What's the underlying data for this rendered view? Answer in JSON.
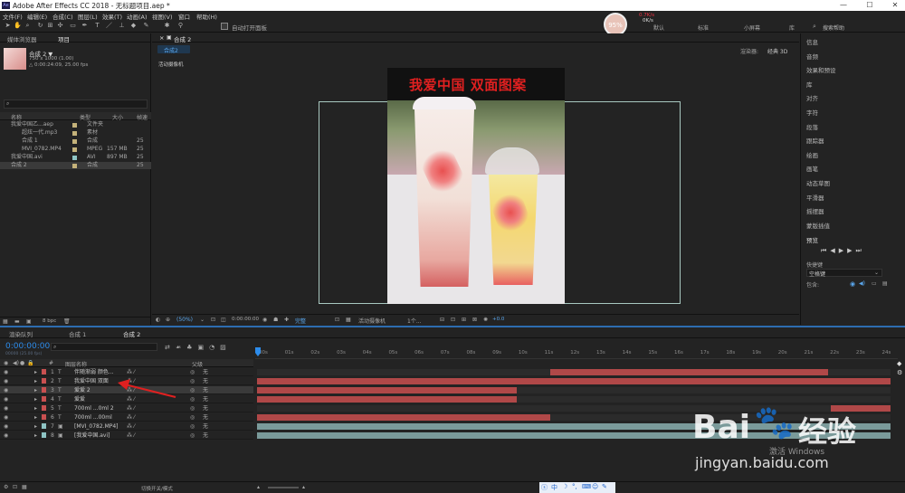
{
  "window": {
    "title": "Adobe After Effects CC 2018 - 无标题项目.aep *",
    "app_icon": "Ae",
    "controls": [
      "—",
      "☐",
      "✕"
    ]
  },
  "menu": [
    "文件(F)",
    "编辑(E)",
    "合成(C)",
    "图层(L)",
    "效果(T)",
    "动画(A)",
    "视图(V)",
    "窗口",
    "帮助(H)"
  ],
  "toolbar": {
    "auto_open_panel": "自动打开面板",
    "workspaces": [
      "默认",
      "标准",
      "小屏幕",
      "库"
    ],
    "search_placeholder": "搜索帮助",
    "speed_badge": "95%",
    "net_up": "0.7K/s",
    "net_down": "0K/s"
  },
  "project_panel": {
    "tabs": [
      "媒体浏览器",
      "项目"
    ],
    "comp_name": "合成 2 ▼",
    "comp_size": "750 x 1000 (1.00)",
    "comp_duration": "△ 0:00:24:09, 25.00 fps",
    "columns": {
      "name": "名称",
      "type": "类型",
      "size": "大小",
      "fps": "帧速"
    },
    "items": [
      {
        "name": "我爱中国乙...aep",
        "type": "文件夹",
        "size": "",
        "fps": "",
        "label_color": "#c4b27a"
      },
      {
        "name": "超炫一代.mp3",
        "type": "素材",
        "size": "",
        "fps": "",
        "label_color": "#c4b27a"
      },
      {
        "name": "合成 1",
        "type": "合成",
        "size": "",
        "fps": "25",
        "label_color": "#c4b27a"
      },
      {
        "name": "MVI_0782.MP4",
        "type": "MPEG",
        "size": "157 MB",
        "fps": "25",
        "label_color": "#c4b27a"
      },
      {
        "name": "我爱中国.avi",
        "type": "AVI",
        "size": "897 MB",
        "fps": "25",
        "label_color": "#8ec4c4"
      },
      {
        "name": "合成 2",
        "type": "合成",
        "size": "",
        "fps": "25",
        "label_color": "#c4b27a"
      }
    ],
    "footer_bpc": "8 bpc"
  },
  "comp_viewer": {
    "tab": "合成 2",
    "breadcrumb": "合成2",
    "renderer_label": "渲染器:",
    "renderer_value": "经典 3D",
    "camera_label": "活动摄像机",
    "video_caption": "我爱中国 双面图案",
    "footer": {
      "zoom": "(50%)",
      "timecode": "0:00:00:00",
      "quality": "完整",
      "camera": "活动摄像机",
      "views": "1个...",
      "offset": "+0.0"
    }
  },
  "right_panel": {
    "items": [
      "信息",
      "音频",
      "效果和预设",
      "库",
      "对齐",
      "字符",
      "段落",
      "跟踪器",
      "绘画",
      "画笔",
      "动态草图",
      "平滑器",
      "摇摆器",
      "蒙版插值"
    ],
    "preview_title": "预览",
    "shortcut_label": "快捷键",
    "shortcut_value": "空格键",
    "include_label": "包含:"
  },
  "timeline": {
    "tabs": [
      "渲染队列",
      "合成 1",
      "合成 2"
    ],
    "timecode": "0:00:00:00",
    "fps_note": "00000 (25.00 fps)",
    "column_source": "图层名称",
    "column_parent": "父级",
    "ruler": [
      "00s",
      "01s",
      "02s",
      "03s",
      "04s",
      "05s",
      "06s",
      "07s",
      "08s",
      "09s",
      "10s",
      "11s",
      "12s",
      "13s",
      "14s",
      "15s",
      "16s",
      "17s",
      "18s",
      "19s",
      "20s",
      "21s",
      "22s",
      "23s",
      "24s"
    ],
    "layers": [
      {
        "num": "1",
        "type": "T",
        "name": "伴随渐弱 颜色...",
        "parent": "无",
        "color": "#c95050",
        "bar_start": 11.3,
        "bar_end": 22.0,
        "selected": false
      },
      {
        "num": "2",
        "type": "T",
        "name": "我爱中国 双面",
        "parent": "无",
        "color": "#c95050",
        "bar_start": 0.0,
        "bar_end": 24.4,
        "selected": false
      },
      {
        "num": "3",
        "type": "T",
        "name": "爱爱 2",
        "parent": "无",
        "color": "#c95050",
        "bar_start": 0.0,
        "bar_end": 10.0,
        "selected": true
      },
      {
        "num": "4",
        "type": "T",
        "name": "爱爱",
        "parent": "无",
        "color": "#c95050",
        "bar_start": 0.0,
        "bar_end": 10.0,
        "selected": false
      },
      {
        "num": "5",
        "type": "T",
        "name": "700ml ...0ml 2",
        "parent": "无",
        "color": "#c95050",
        "bar_start": 22.1,
        "bar_end": 24.4,
        "selected": false
      },
      {
        "num": "6",
        "type": "T",
        "name": "700ml ...00ml",
        "parent": "无",
        "color": "#c95050",
        "bar_start": 0.0,
        "bar_end": 11.3,
        "selected": false
      },
      {
        "num": "7",
        "type": "▣",
        "name": "[MVI_0782.MP4]",
        "parent": "无",
        "color": "#8ec4c4",
        "bar_start": 0.0,
        "bar_end": 24.4,
        "selected": false
      },
      {
        "num": "8",
        "type": "▣",
        "name": "[我爱中国.avi]",
        "parent": "无",
        "color": "#8ec4c4",
        "bar_start": 0.0,
        "bar_end": 24.4,
        "selected": false
      }
    ],
    "footer_switches": "切换开关/模式",
    "ime_text": "中"
  },
  "watermark": {
    "brand": "Bai",
    "brand2": "经验",
    "url": "jingyan.baidu.com",
    "win": "激活 Windows"
  }
}
